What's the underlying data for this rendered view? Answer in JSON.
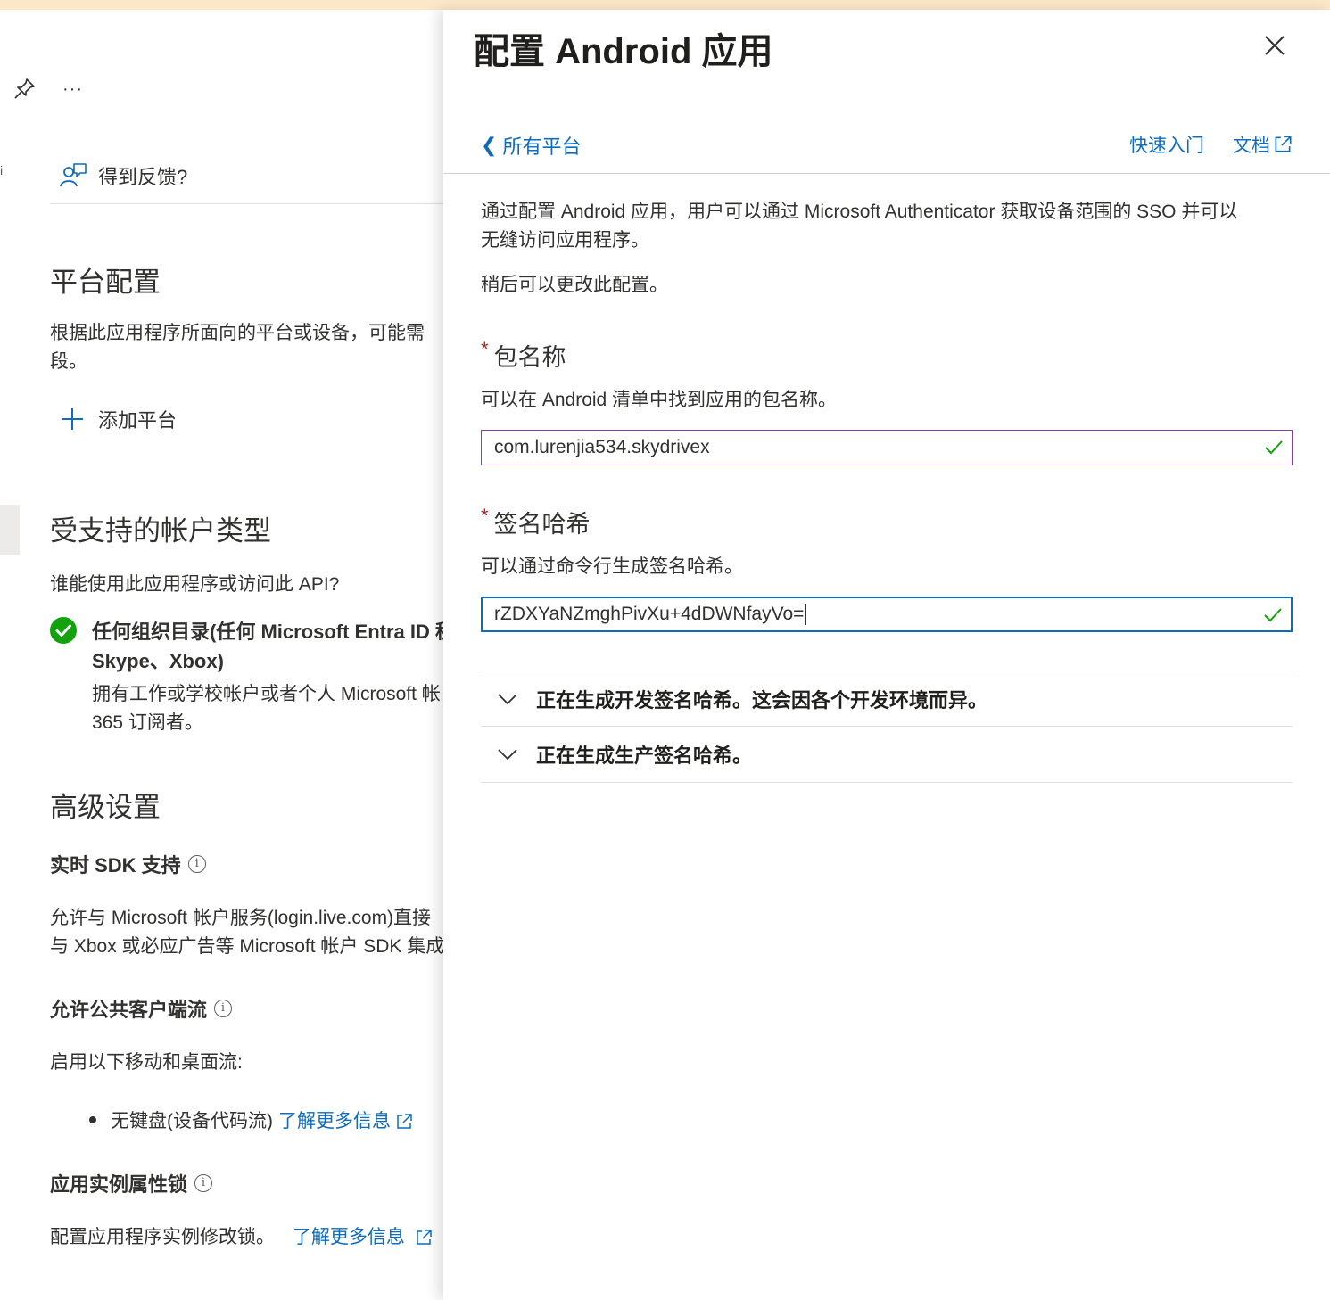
{
  "left": {
    "more_label": "···",
    "edge_mark": "i",
    "feedback_label": "得到反馈?",
    "platform_heading": "平台配置",
    "platform_desc_line1": "根据此应用程序所面向的平台或设备，可能需",
    "platform_desc_line2": "段。",
    "add_platform_label": "添加平台",
    "account_heading": "受支持的帐户类型",
    "account_question": "谁能使用此应用程序或访问此 API?",
    "option_title_line1": "任何组织目录(任何 Microsoft Entra ID 租",
    "option_title_line2": "Skype、Xbox)",
    "option_desc_line1": "拥有工作或学校帐户或者个人 Microsoft 帐",
    "option_desc_line2": "365 订阅者。",
    "advanced_heading": "高级设置",
    "sdk_heading": "实时 SDK 支持",
    "sdk_desc_line1": "允许与 Microsoft 帐户服务(login.live.com)直接",
    "sdk_desc_line2": "与 Xbox 或必应广告等 Microsoft 帐户 SDK 集成",
    "public_client_heading": "允许公共客户端流",
    "public_client_desc": "启用以下移动和桌面流:",
    "bullet_text": "无键盘(设备代码流)",
    "learn_more": "了解更多信息",
    "lock_heading": "应用实例属性锁",
    "lock_desc": "配置应用程序实例修改锁。",
    "lock_learn_more": "了解更多信息"
  },
  "panel": {
    "title": "配置 Android 应用",
    "back_label": "所有平台",
    "quickstart_label": "快速入门",
    "docs_label": "文档",
    "intro_line1": "通过配置 Android 应用，用户可以通过 Microsoft Authenticator 获取设备范围的 SSO 并可以",
    "intro_line2": "无缝访问应用程序。",
    "intro_note": "稍后可以更改此配置。",
    "package_label": "包名称",
    "package_help": "可以在 Android 清单中找到应用的包名称。",
    "package_value": "com.lurenjia534.skydrivex",
    "signature_label": "签名哈希",
    "signature_help": "可以通过命令行生成签名哈希。",
    "signature_value": "rZDXYaNZmghPivXu+4dDWNfayVo=",
    "accordion_dev": "正在生成开发签名哈希。这会因各个开发环境而异。",
    "accordion_prod": "正在生成生产签名哈希。",
    "required_marker": "*"
  },
  "colors": {
    "link": "#0f6cbd",
    "success": "#13a10e",
    "required": "#a4262c",
    "top_bar": "#fde7c9"
  }
}
